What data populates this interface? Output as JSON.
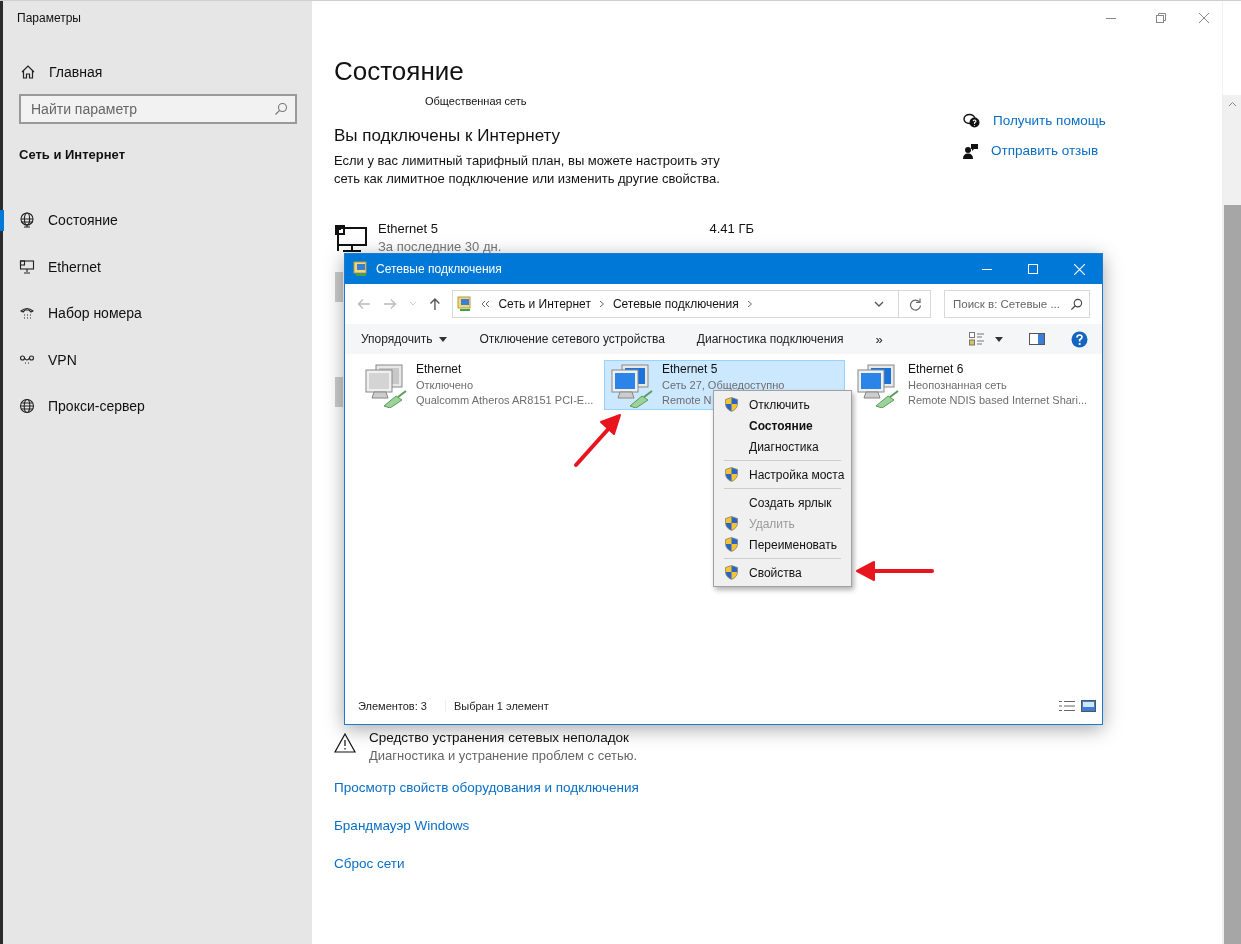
{
  "window": {
    "title": "Параметры"
  },
  "sidebar": {
    "home": "Главная",
    "search": {
      "placeholder": "Найти параметр"
    },
    "section": "Сеть и Интернет",
    "items": [
      {
        "label": "Состояние",
        "selected": true
      },
      {
        "label": "Ethernet",
        "selected": false
      },
      {
        "label": "Набор номера",
        "selected": false
      },
      {
        "label": "VPN",
        "selected": false
      },
      {
        "label": "Прокси-сервер",
        "selected": false
      }
    ]
  },
  "main": {
    "title": "Состояние",
    "network_type": "Общественная сеть",
    "headline": "Вы подключены к Интернету",
    "description": "Если у вас лимитный тарифный план, вы можете настроить эту сеть как лимитное подключение или изменить другие свойства.",
    "adapter": {
      "name": "Ethernet 5",
      "period": "За последние 30 дн.",
      "usage": "4.41 ГБ"
    },
    "troubleshooter": {
      "title": "Средство устранения сетевых неполадок",
      "subtitle": "Диагностика и устранение проблем с сетью."
    },
    "links": [
      "Просмотр свойств оборудования и подключения",
      "Брандмауэр Windows",
      "Сброс сети"
    ]
  },
  "help_links": [
    "Получить помощь",
    "Отправить отзыв"
  ],
  "explorer": {
    "title": "Сетевые подключения",
    "breadcrumb": [
      "Сеть и Интернет",
      "Сетевые подключения"
    ],
    "search": {
      "placeholder": "Поиск в: Сетевые ..."
    },
    "commands": [
      "Упорядочить",
      "Отключение сетевого устройства",
      "Диагностика подключения"
    ],
    "more": "»",
    "items": [
      {
        "name": "Ethernet",
        "status": "Отключено",
        "device": "Qualcomm Atheros AR8151 PCI-E...",
        "enabled": false,
        "selected": false
      },
      {
        "name": "Ethernet 5",
        "status": "Сеть 27, Общедоступно",
        "device": "Remote N",
        "enabled": true,
        "selected": true
      },
      {
        "name": "Ethernet 6",
        "status": "Неопознанная сеть",
        "device": "Remote NDIS based Internet Shari...",
        "enabled": true,
        "selected": false
      }
    ],
    "context_menu": [
      {
        "kind": "item",
        "label": "Отключить",
        "shield": true,
        "default": false,
        "disabled": false
      },
      {
        "kind": "item",
        "label": "Состояние",
        "shield": false,
        "default": true,
        "disabled": false
      },
      {
        "kind": "item",
        "label": "Диагностика",
        "shield": false,
        "default": false,
        "disabled": false
      },
      {
        "kind": "separator"
      },
      {
        "kind": "item",
        "label": "Настройка моста",
        "shield": true,
        "default": false,
        "disabled": false
      },
      {
        "kind": "separator"
      },
      {
        "kind": "item",
        "label": "Создать ярлык",
        "shield": false,
        "default": false,
        "disabled": false
      },
      {
        "kind": "item",
        "label": "Удалить",
        "shield": true,
        "default": false,
        "disabled": true
      },
      {
        "kind": "item",
        "label": "Переименовать",
        "shield": true,
        "default": false,
        "disabled": false
      },
      {
        "kind": "separator"
      },
      {
        "kind": "item",
        "label": "Свойства",
        "shield": true,
        "default": false,
        "disabled": false
      }
    ],
    "status_bar": [
      "Элементов: 3",
      "Выбран 1 элемент"
    ]
  }
}
